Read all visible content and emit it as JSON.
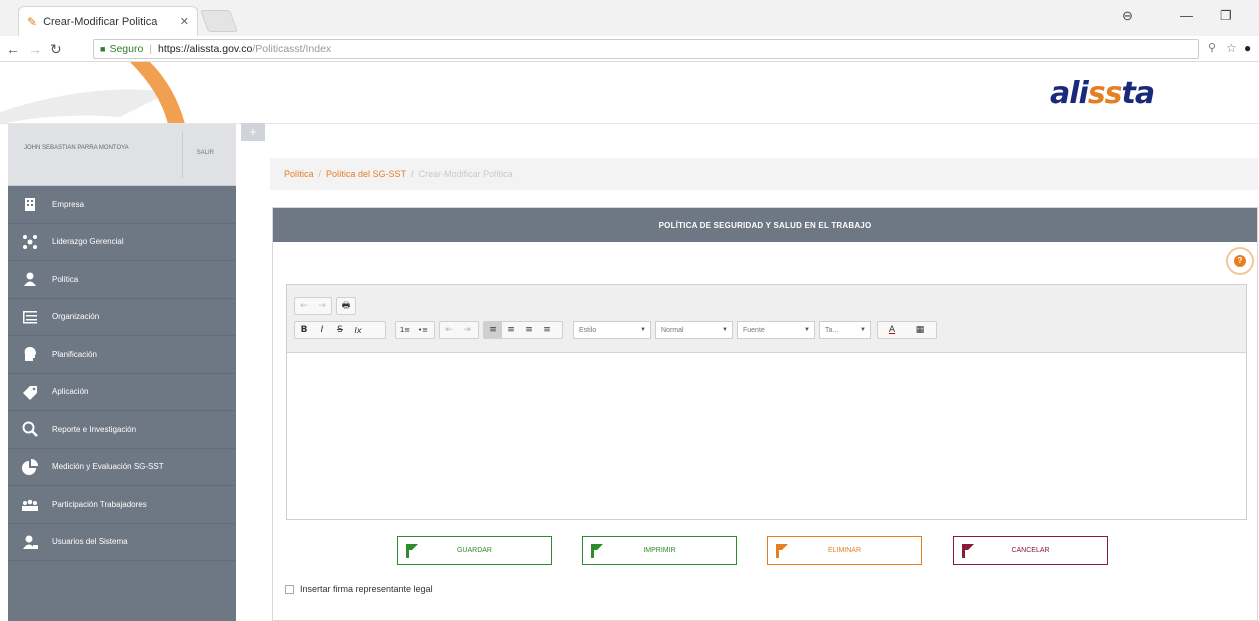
{
  "browser": {
    "tab_title": "Crear-Modificar Politica",
    "secure_label": "Seguro",
    "url_host": "https://alissta.gov.co",
    "url_path": "/Politicasst/Index"
  },
  "sidebar": {
    "user_name": "JOHN SEBASTIAN PARRA MONTOYA",
    "exit_label": "SALIR",
    "items": [
      {
        "label": "Empresa",
        "icon": "building-icon"
      },
      {
        "label": "Liderazgo Gerencial",
        "icon": "people-network-icon"
      },
      {
        "label": "Política",
        "icon": "user-icon"
      },
      {
        "label": "Organización",
        "icon": "list-icon"
      },
      {
        "label": "Planificación",
        "icon": "head-icon"
      },
      {
        "label": "Aplicación",
        "icon": "tag-icon"
      },
      {
        "label": "Reporte e Investigación",
        "icon": "search-icon"
      },
      {
        "label": "Medición y Evaluación SG-SST",
        "icon": "pie-chart-icon"
      },
      {
        "label": "Participación Trabajadores",
        "icon": "group-icon"
      },
      {
        "label": "Usuarios del Sistema",
        "icon": "user-admin-icon"
      }
    ]
  },
  "breadcrumb": {
    "item1": "Política",
    "item2": "Política del SG-SST",
    "current": "Crear-Modificar Política",
    "separator": "/"
  },
  "panel": {
    "title": "POLÍTICA DE SEGURIDAD Y SALUD EN EL TRABAJO"
  },
  "toolbar": {
    "undo": "←",
    "redo": "→",
    "print": "🖶",
    "bold": "B",
    "italic": "I",
    "strike": "S",
    "clear_format": "Ix",
    "numbered_list": "1≡",
    "bulleted_list": "•≡",
    "outdent": "⇤",
    "indent": "⇥",
    "align_left": "≡",
    "align_center": "≡",
    "align_right": "≡",
    "align_justify": "≡",
    "style_combo": "Estilo",
    "format_combo": "Normal",
    "font_combo": "Fuente",
    "size_combo": "Ta...",
    "text_color": "A",
    "bg_color": "▦"
  },
  "buttons": {
    "save": "GUARDAR",
    "print": "IMPRIMIR",
    "delete": "ELIMINAR",
    "cancel": "CANCELAR"
  },
  "sign_checkbox_label": "Insertar firma representante legal",
  "colors": {
    "accent": "#e67e22",
    "sidebar_bg": "#6e7784",
    "save_green": "#2e8b2e",
    "delete_orange": "#e67e22",
    "cancel_maroon": "#8b1a3a"
  }
}
